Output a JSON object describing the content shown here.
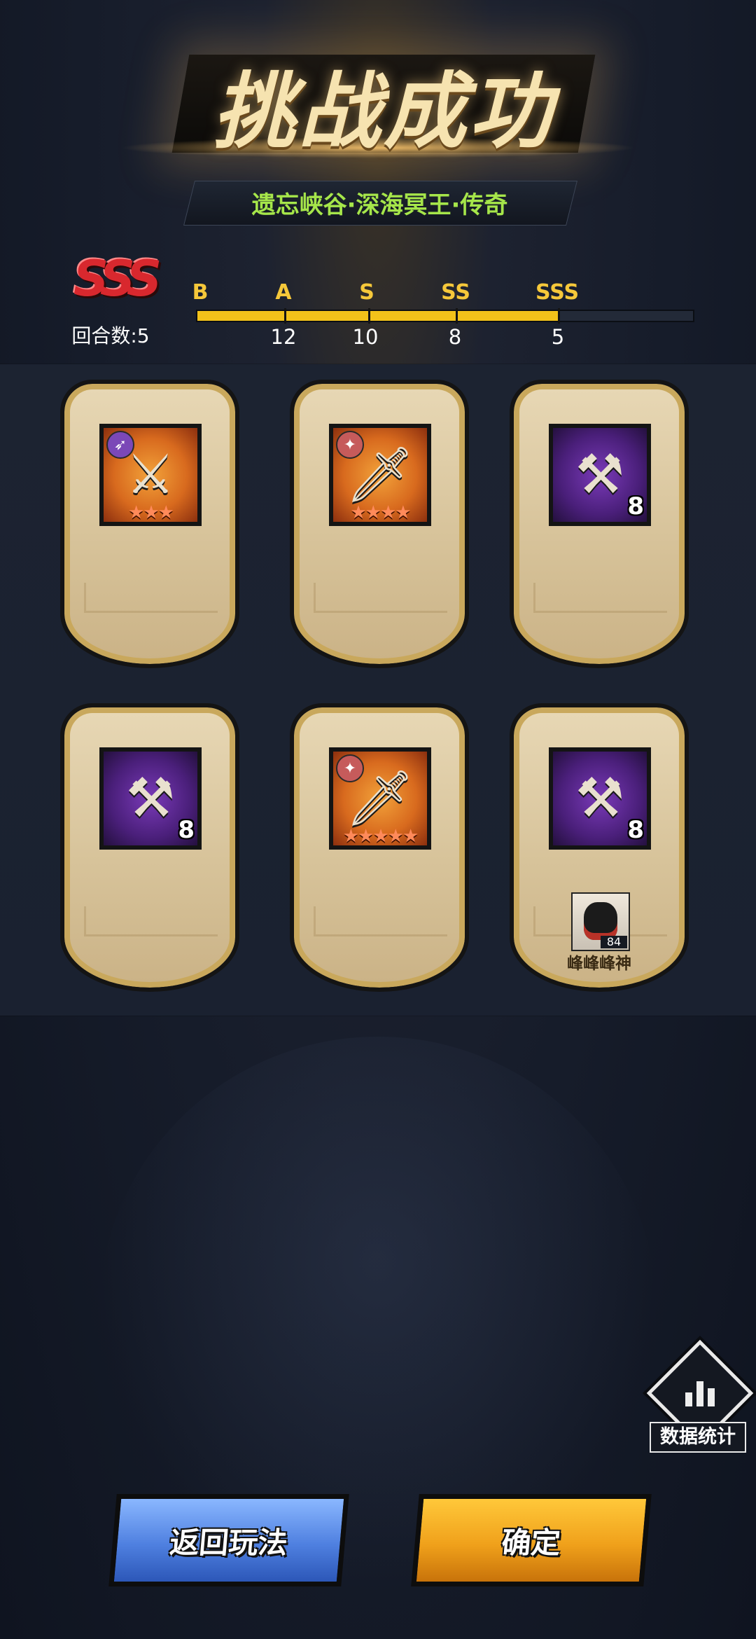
{
  "header": {
    "title": "挑战成功",
    "subtitle": "遗忘峡谷·深海冥王·传奇"
  },
  "rating": {
    "rank": "SSS",
    "rounds_label": "回合数:5",
    "progress_fraction": 0.73,
    "grades": [
      {
        "letter": "B",
        "rounds": ""
      },
      {
        "letter": "A",
        "rounds": "12"
      },
      {
        "letter": "S",
        "rounds": "10"
      },
      {
        "letter": "SS",
        "rounds": "8"
      },
      {
        "letter": "SSS",
        "rounds": "5"
      }
    ]
  },
  "rewards": [
    {
      "icon": "crossbow-icon",
      "type_icon": "bow-type-icon",
      "rarity": "orange",
      "stars": "★★★",
      "count": ""
    },
    {
      "icon": "sword-icon",
      "type_icon": "sword-type-icon",
      "rarity": "orange",
      "stars": "★★★★",
      "count": ""
    },
    {
      "icon": "hammer-icon",
      "type_icon": "",
      "rarity": "purple",
      "stars": "",
      "count": "8"
    },
    {
      "icon": "hammer-icon",
      "type_icon": "",
      "rarity": "purple",
      "stars": "",
      "count": "8"
    },
    {
      "icon": "dagger-icon",
      "type_icon": "sword-type-icon",
      "rarity": "orange",
      "stars": "★★★★★",
      "count": ""
    },
    {
      "icon": "hammer-icon",
      "type_icon": "",
      "rarity": "purple",
      "stars": "",
      "count": "8",
      "hero": {
        "level": "84",
        "name": "峰峰峰神"
      }
    }
  ],
  "stats_button": {
    "label": "数据统计",
    "icon": "bar-chart-icon"
  },
  "buttons": {
    "back": "返回玩法",
    "confirm": "确定"
  },
  "colors": {
    "grade_fill": "#f2c21a",
    "subtitle_green": "#a6e64a",
    "back_button_blue": "#4f80e0",
    "confirm_button_gold": "#f0a11b",
    "rarity_orange": "#d86a1e",
    "rarity_purple": "#4a1f7a"
  }
}
